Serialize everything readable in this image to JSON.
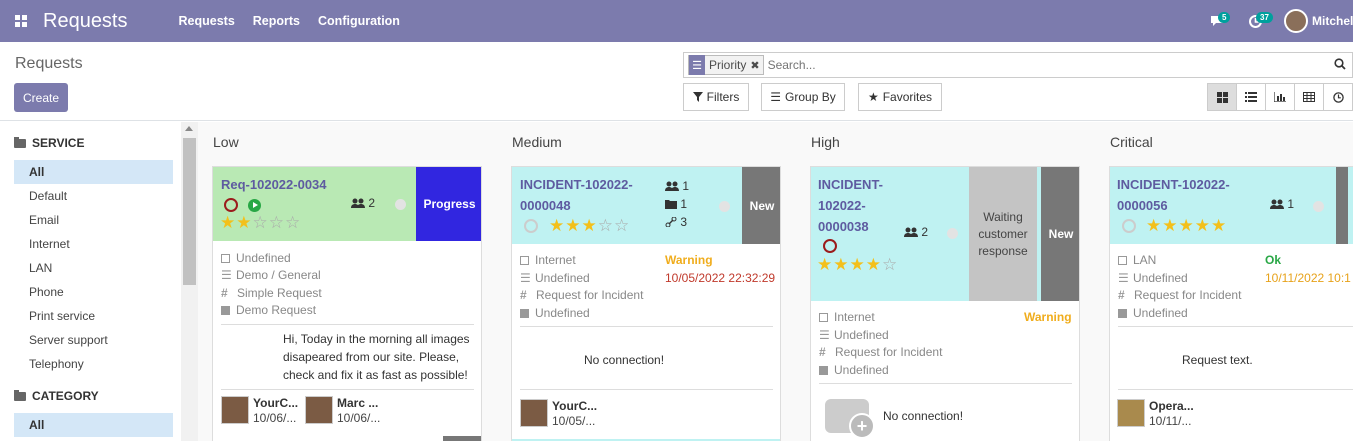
{
  "navbar": {
    "brand": "Requests",
    "menu": [
      "Requests",
      "Reports",
      "Configuration"
    ],
    "chat_count": "5",
    "activity_count": "37",
    "user": "Mitchell"
  },
  "control": {
    "breadcrumb": "Requests",
    "create": "Create",
    "facet_value": "Priority",
    "search_placeholder": "Search...",
    "filters": "Filters",
    "group_by": "Group By",
    "favorites": "Favorites"
  },
  "sidebar": {
    "service": {
      "title": "SERVICE",
      "items": [
        "All",
        "Default",
        "Email",
        "Internet",
        "LAN",
        "Phone",
        "Print service",
        "Server support",
        "Telephony"
      ]
    },
    "category": {
      "title": "CATEGORY",
      "items": [
        "All"
      ]
    }
  },
  "columns": [
    {
      "title": "Low",
      "card": {
        "name": "Req-102022-0034",
        "stars": 2,
        "followers": "2",
        "stage": "Progress",
        "stage_color": "#3126e0",
        "top_color": "#b9e9b4",
        "attrs": [
          "Undefined",
          "Demo / General",
          "Simple Request",
          "Demo Request"
        ],
        "description": "Hi, Today in the morning all images disapeared from our site. Please, check and fix it as fast as possible!",
        "people": [
          {
            "name": "YourC...",
            "date": "10/06/..."
          },
          {
            "name": "Marc ...",
            "date": "10/06/..."
          }
        ]
      }
    },
    {
      "title": "Medium",
      "card": {
        "name": "INCIDENT-102022-0000048",
        "stars": 3,
        "followers": "1",
        "files": "1",
        "links": "3",
        "stage": "New",
        "stage_color": "#777777",
        "top_color": "#bff2f2",
        "status": "Warning",
        "status_color": "#f0ad1d",
        "stamp": "10/05/2022 22:32:29",
        "stamp_color": "#c0392b",
        "attrs": [
          "Internet",
          "Undefined",
          "Request for Incident",
          "Undefined"
        ],
        "description": "No connection!",
        "people": [
          {
            "name": "YourC...",
            "date": "10/05/..."
          }
        ]
      }
    },
    {
      "title": "High",
      "card": {
        "name": "INCIDENT-102022-0000038",
        "stars": 4,
        "followers": "2",
        "stage": "New",
        "stage_color": "#777777",
        "top_color": "#bff2f2",
        "tag": "Waiting customer response",
        "attrs": [
          "Internet",
          "Undefined",
          "Request for Incident",
          "Undefined"
        ],
        "status": "Warning",
        "status_color": "#f0ad1d",
        "description": "No connection!"
      }
    },
    {
      "title": "Critical",
      "card": {
        "name": "INCIDENT-102022-0000056",
        "stars": 5,
        "followers": "1",
        "top_color": "#bff2f2",
        "status": "Ok",
        "status_color": "#28a745",
        "stamp": "10/11/2022 10:1",
        "stamp_color": "#e7a21a",
        "attrs": [
          "LAN",
          "Undefined",
          "Request for Incident",
          "Undefined"
        ],
        "description": "Request text.",
        "people": [
          {
            "name": "Opera...",
            "date": "10/11/..."
          }
        ]
      }
    }
  ]
}
